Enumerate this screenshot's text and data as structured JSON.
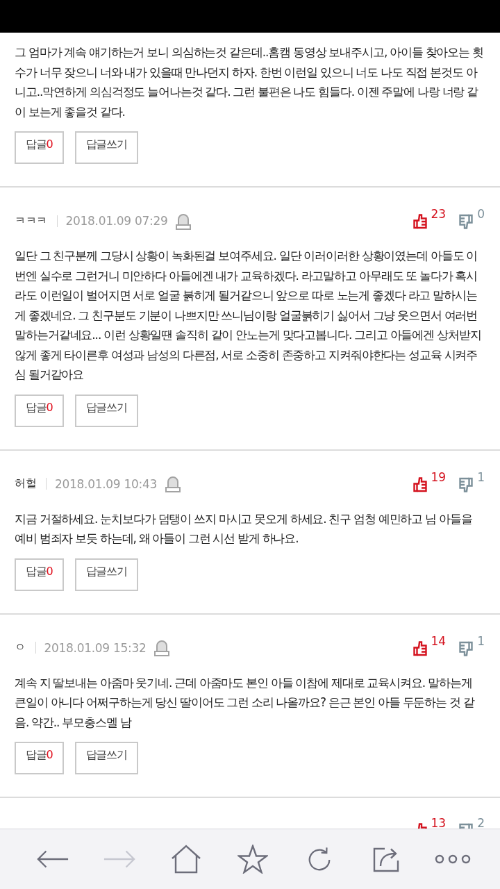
{
  "comments": [
    {
      "body": "그 엄마가 계속 얘기하는거 보니 의심하는것 같은데..홈캠 동영상 보내주시고, 아이들 찾아오는 횟수가 너무 잦으니 너와 내가 있을때 만나던지 하자. 한번 이런일 있으니 너도 나도 직접 본것도 아니고..막연하게 의심걱정도 늘어나는것 같다. 그런 불편은 나도 힘들다. 이젠 주말에 나랑 너랑 같이 보는게 좋을것 같다.",
      "reply_button": {
        "label": "답글",
        "count": "0"
      },
      "write_button": "답글쓰기"
    },
    {
      "author": "ㅋㅋㅋ",
      "date": "2018.01.09 07:29",
      "likes": "23",
      "dislikes": "0",
      "body": "일단 그 친구분께 그당시 상황이 녹화된걸 보여주세요. 일단 이러이러한 상황이였는데 아들도 이번엔 실수로 그런거니 미안하다 아들에겐 내가 교육하겠다. 라고말하고 아무래도 또 놀다가 혹시라도 이런일이 벌어지면 서로 얼굴 붉히게 될거같으니 앞으로 따로 노는게 좋겠다 라고 말하시는게 좋겠네요. 그 친구분도 기분이 나쁘지만 쓰니님이랑 얼굴붉히기 싫어서 그냥 웃으면서 여러번 말하는거같네요... 이런 상황일땐 솔직히 같이 안노는게 맞다고봅니다. 그리고 아들에겐 상처받지 않게 좋게 타이른후 여성과 남성의 다른점, 서로 소중히 존중하고 지켜줘야한다는 성교육 시켜주심 될거같아요",
      "reply_button": {
        "label": "답글",
        "count": "0"
      },
      "write_button": "답글쓰기"
    },
    {
      "author": "허헐",
      "date": "2018.01.09 10:43",
      "likes": "19",
      "dislikes": "1",
      "body": "지금 거절하세요. 눈치보다가 덤탱이 쓰지 마시고 못오게 하세요. 친구 엄청 예민하고 님 아들을 예비 범죄자 보듯 하는데, 왜 아들이 그런 시선 받게 하나요.",
      "reply_button": {
        "label": "답글",
        "count": "0"
      },
      "write_button": "답글쓰기"
    },
    {
      "author": "ㅇ",
      "date": "2018.01.09 15:32",
      "likes": "14",
      "dislikes": "1",
      "body": "계속 지 딸보내는 아줌마 웃기네. 근데 아줌마도 본인 아들 이참에 제대로 교육시켜요. 말하는게 큰일이 아니다 어쩌구하는게 당신 딸이어도 그런 소리 나올까요? 은근 본인 아들 두둔하는 것 같음. 약간.. 부모충스멜 남",
      "reply_button": {
        "label": "답글",
        "count": "0"
      },
      "write_button": "답글쓰기"
    },
    {
      "likes": "13",
      "dislikes": "2",
      "cut_off": true
    }
  ],
  "toolbar": [
    {
      "kind": "back",
      "disabled": false
    },
    {
      "kind": "forward",
      "disabled": true
    },
    {
      "kind": "home",
      "disabled": false
    },
    {
      "kind": "star",
      "disabled": false
    },
    {
      "kind": "refresh",
      "disabled": false
    },
    {
      "kind": "share",
      "disabled": false
    },
    {
      "kind": "more",
      "disabled": false
    }
  ]
}
